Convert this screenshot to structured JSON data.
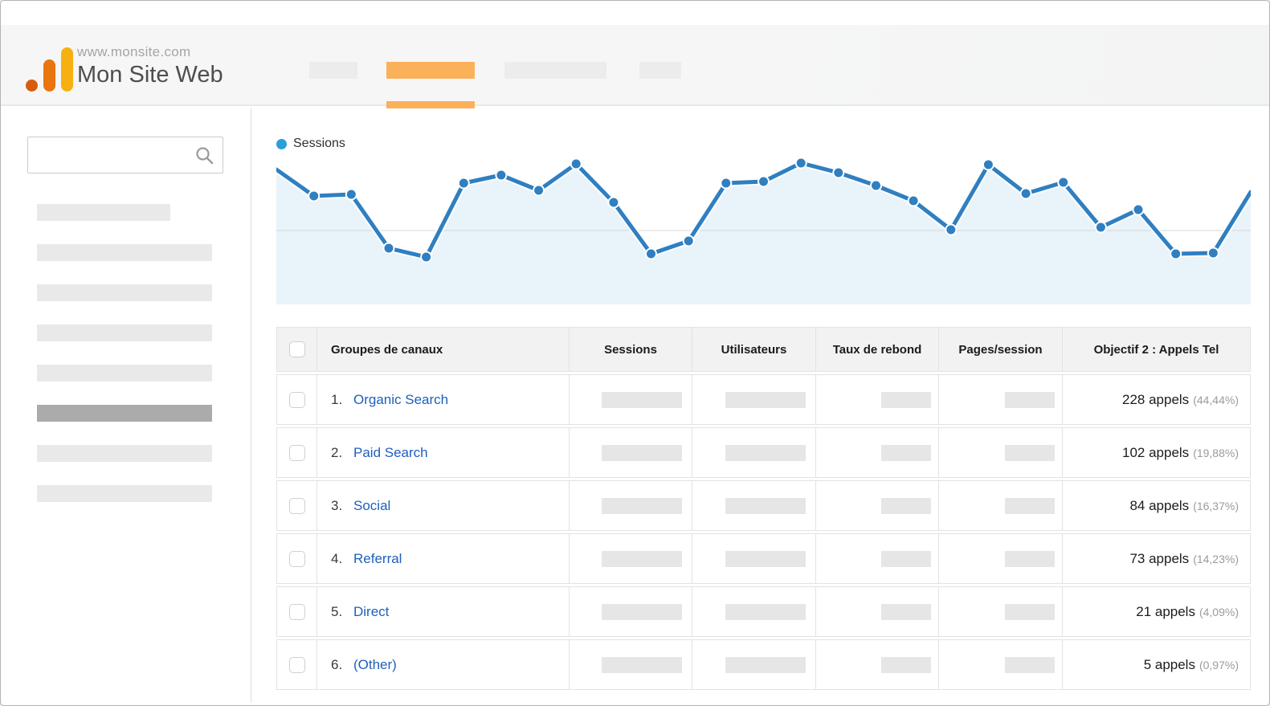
{
  "colors": {
    "accent_orange": "#fbb05a",
    "logo_dot": "#d85c0f",
    "logo_bar_mid": "#e8750f",
    "logo_bar_tall": "#f6b111",
    "chart_line_blue": "#2f7fc1",
    "chart_fill_blue": "#e9f3fa",
    "legend_dot_blue": "#2b9fd8",
    "link_blue": "#1e5fbe",
    "sidebar_active_gray": "#ababab"
  },
  "header": {
    "site_url": "www.monsite.com",
    "site_name": "Mon Site Web",
    "tabs": [
      {
        "id": "tab-1",
        "active": false
      },
      {
        "id": "tab-2",
        "active": true
      },
      {
        "id": "tab-3",
        "active": false
      },
      {
        "id": "tab-4",
        "active": false
      }
    ]
  },
  "sidebar": {
    "search_value": "",
    "items": [
      {
        "active": false,
        "short": true
      },
      {
        "active": false,
        "short": false
      },
      {
        "active": false,
        "short": false
      },
      {
        "active": false,
        "short": false
      },
      {
        "active": false,
        "short": false
      },
      {
        "active": true,
        "short": false
      },
      {
        "active": false,
        "short": false
      },
      {
        "active": false,
        "short": false
      }
    ]
  },
  "legend": {
    "label": "Sessions"
  },
  "chart_data": {
    "type": "line",
    "title": "",
    "legend_entries": [
      "Sessions"
    ],
    "xlabel": "",
    "ylabel": "",
    "axis_labels_visible": false,
    "ylim": [
      0,
      188
    ],
    "gridline_value": 92,
    "grid": "single-horizontal-line",
    "legend_position": "top-left",
    "series": [
      {
        "name": "Sessions",
        "values": [
          168,
          135,
          137,
          70,
          59,
          151,
          161,
          142,
          175,
          127,
          63,
          79,
          151,
          153,
          176,
          164,
          148,
          129,
          93,
          174,
          138,
          152,
          96,
          118,
          63,
          64,
          140
        ]
      }
    ]
  },
  "table": {
    "columns": [
      "",
      "Groupes de canaux",
      "Sessions",
      "Utilisateurs",
      "Taux de rebond",
      "Pages/session",
      "Objectif 2 : Appels Tel"
    ],
    "rows": [
      {
        "rank": "1.",
        "channel": "Organic Search",
        "objective_value": "228 appels",
        "objective_pct": "(44,44%)"
      },
      {
        "rank": "2.",
        "channel": "Paid Search",
        "objective_value": "102 appels",
        "objective_pct": "(19,88%)"
      },
      {
        "rank": "3.",
        "channel": "Social",
        "objective_value": "84 appels",
        "objective_pct": "(16,37%)"
      },
      {
        "rank": "4.",
        "channel": "Referral",
        "objective_value": "73 appels",
        "objective_pct": "(14,23%)"
      },
      {
        "rank": "5.",
        "channel": "Direct",
        "objective_value": "21 appels",
        "objective_pct": "(4,09%)"
      },
      {
        "rank": "6.",
        "channel": "(Other)",
        "objective_value": "5 appels",
        "objective_pct": "(0,97%)"
      }
    ]
  }
}
